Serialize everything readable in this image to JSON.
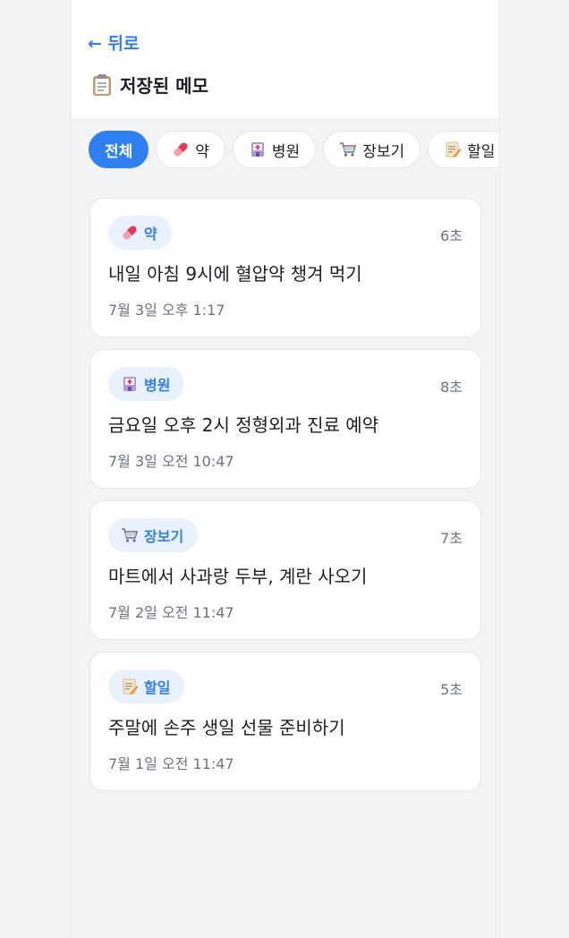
{
  "header": {
    "back_label": "← 뒤로",
    "title": "저장된 메모",
    "title_icon": "clipboard-icon"
  },
  "filters": [
    {
      "label": "전체",
      "icon": null,
      "active": true
    },
    {
      "label": "약",
      "icon": "pill-icon",
      "active": false
    },
    {
      "label": "병원",
      "icon": "hospital-icon",
      "active": false
    },
    {
      "label": "장보기",
      "icon": "shopping-cart-icon",
      "active": false
    },
    {
      "label": "할일",
      "icon": "memo-icon",
      "active": false
    }
  ],
  "memos": [
    {
      "category": "약",
      "icon": "pill-icon",
      "elapsed": "6초",
      "text": "내일 아침 9시에 혈압약 챙겨 먹기",
      "date": "7월 3일 오후 1:17"
    },
    {
      "category": "병원",
      "icon": "hospital-icon",
      "elapsed": "8초",
      "text": "금요일 오후 2시 정형외과 진료 예약",
      "date": "7월 3일 오전 10:47"
    },
    {
      "category": "장보기",
      "icon": "shopping-cart-icon",
      "elapsed": "7초",
      "text": "마트에서 사과랑 두부, 계란 사오기",
      "date": "7월 2일 오전 11:47"
    },
    {
      "category": "할일",
      "icon": "memo-icon",
      "elapsed": "5초",
      "text": "주말에 손주 생일 선물 준비하기",
      "date": "7월 1일 오전 11:47"
    }
  ],
  "colors": {
    "accent": "#2f7ff0",
    "badge_bg": "#e8f1fd",
    "background": "#f2f3f5",
    "muted_text": "#6b7280"
  }
}
